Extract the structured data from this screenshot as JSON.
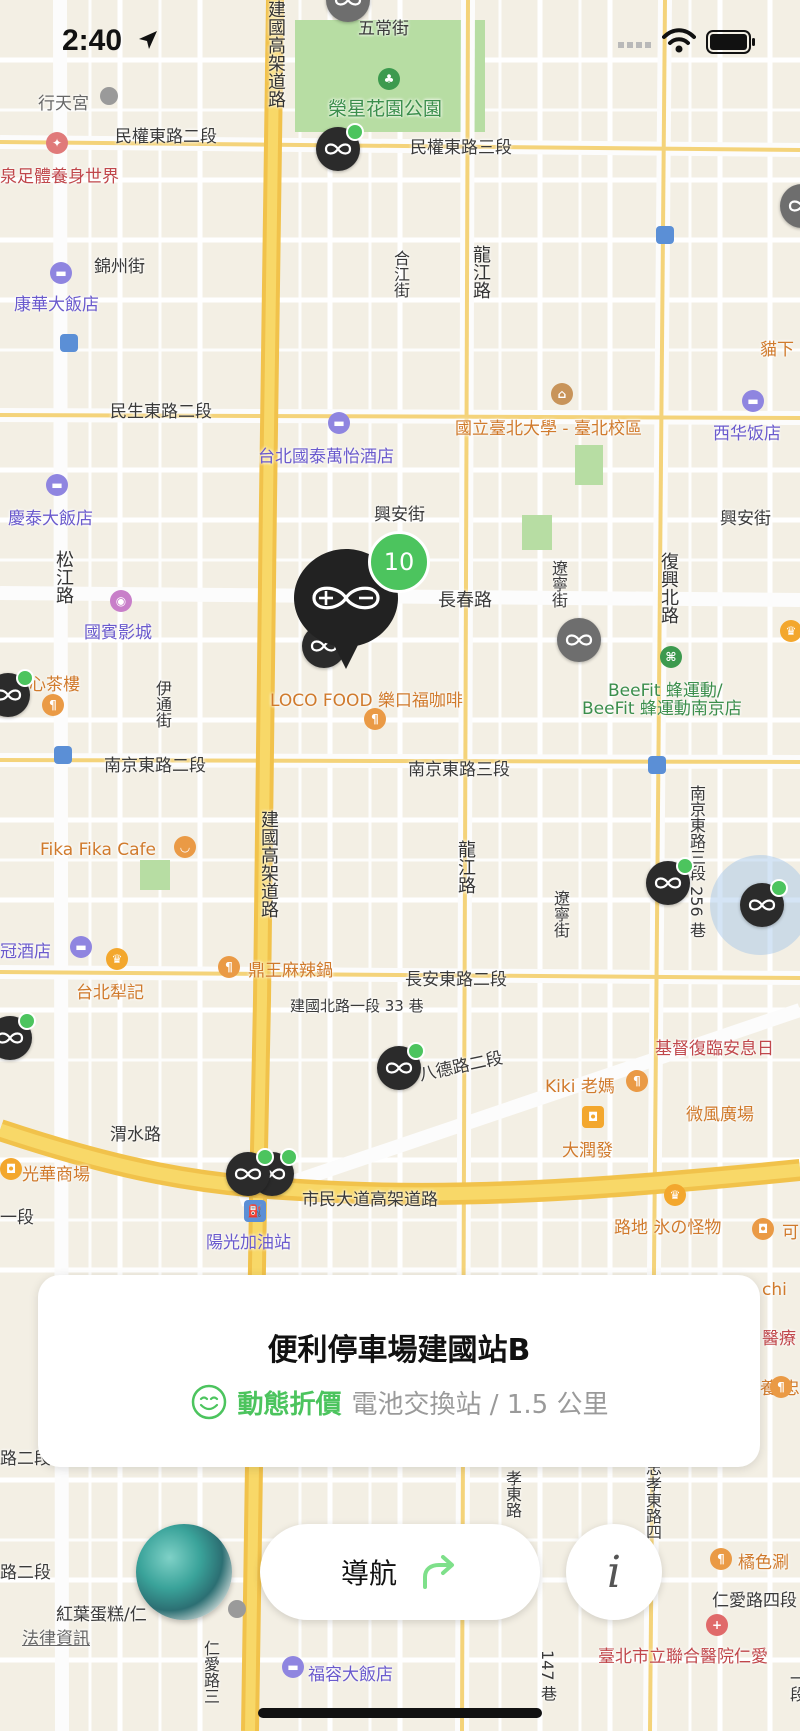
{
  "status_bar": {
    "time": "2:40"
  },
  "map": {
    "labels": {
      "park": "榮星花園公園",
      "wuchang": "五常街",
      "xingtian": "行天宮",
      "minquan2": "民權東路二段",
      "minquan3": "民權東路三段",
      "foot_spa": "泉足體養身世界",
      "jinzhou": "錦州街",
      "kanghua": "康華大飯店",
      "hejiang": "合江街",
      "longjiang": "龍江路",
      "maoxia": "貓下",
      "minsheng2": "民生東路二段",
      "ntu": "國立臺北大學 - 臺北校區",
      "xihua": "西华饭店",
      "cathay_hotel": "台北國泰萬怡酒店",
      "xingan": "興安街",
      "xingan_east": "興安街",
      "qingtai": "慶泰大飯店",
      "songjiang": "松江路",
      "changchun": "長春路",
      "liaoning": "遼寧街",
      "fuxing_north": "復興北路",
      "guobin": "國賓影城",
      "tea_house": "養心茶樓",
      "yitong": "伊通街",
      "loco_food": "LOCO FOOD 樂口福咖啡",
      "beefit1": "BeeFit 蜂運動/",
      "beefit2": "BeeFit 蜂運動南京店",
      "nanjing2": "南京東路二段",
      "nanjing3": "南京東路三段",
      "jianguo_elevated": "建國高架道路",
      "jianguo_elevated_top": "建國高架道路",
      "fika": "Fika Fika Cafe",
      "longjiang2": "龍江路",
      "liaoning2": "遼寧街",
      "lane256": "南京東路三段 256 巷",
      "crown_hotel": "冠酒店",
      "taipei_lee": "台北犁記",
      "dingwang": "鼎王麻辣鍋",
      "changan": "長安東路二段",
      "jianguo_lane33": "建國北路一段 33 巷",
      "bade": "八德路二段",
      "kiki": "Kiki 老媽",
      "church": "基督復臨安息日",
      "weishui": "渭水路",
      "darunfa": "大潤發",
      "weifeng": "微風廣場",
      "guangfu": "光華商場",
      "civic_elevated": "市民大道高架道路",
      "yiduan": "一段",
      "sunlight_gas": "陽光加油站",
      "lude": "路地 氷の怪物",
      "ke": "可",
      "chi": "chi",
      "renai_road": "仁愛路四段",
      "xiaodong": "孝東路",
      "zhongxiao": "忠孝東路四",
      "juse": "橘色涮",
      "hospital": "臺北市立聯合醫院仁愛",
      "hongye": "紅葉蛋糕/仁",
      "legal": "法律資訊",
      "furong": "福容大飯店",
      "renai_side": "仁愛路三",
      "lane147": "147 巷",
      "yiduan2": "一段",
      "erduan": "路二段",
      "erduan2": "路二段",
      "yiyao": "醫療",
      "zhong": "養/忠"
    },
    "cluster": {
      "count": "10"
    }
  },
  "station_card": {
    "name": "便利停車場建國站B",
    "price_tag": "動態折價",
    "meta": "電池交換站 / 1.5 公里"
  },
  "actions": {
    "navigate_label": "導航",
    "info_label": "i"
  },
  "colors": {
    "accent_green": "#4cc45e",
    "pin_dark": "#2b2b2b",
    "map_bg": "#f3efe4"
  }
}
